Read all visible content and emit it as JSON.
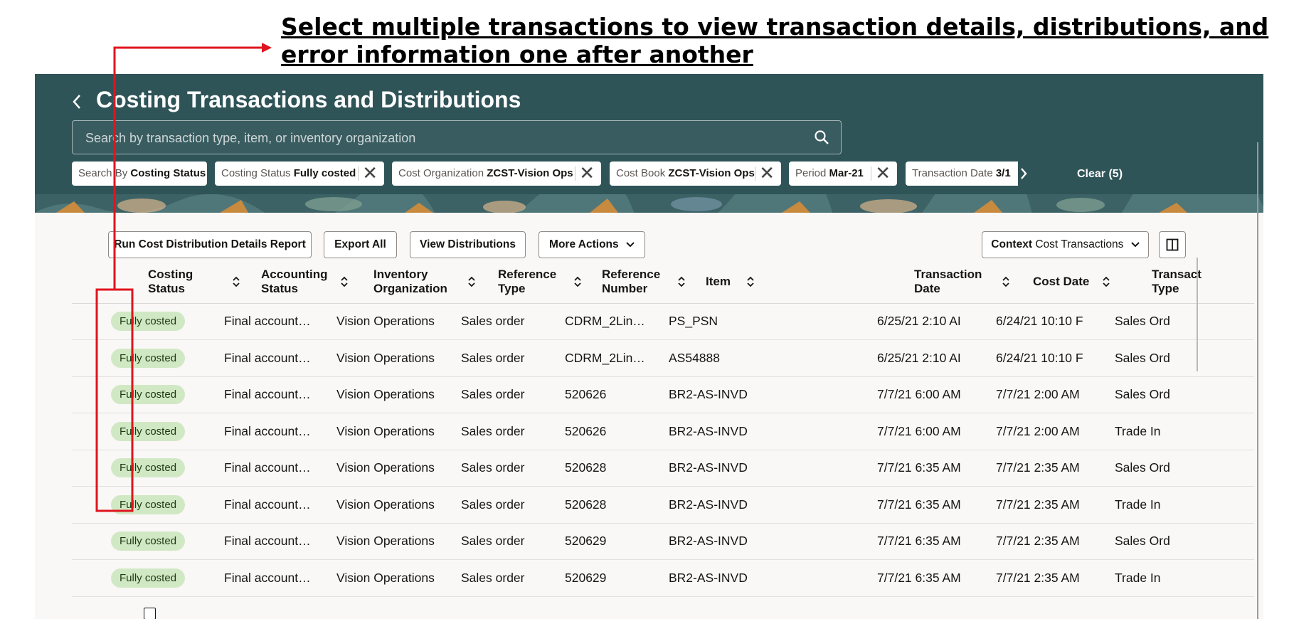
{
  "annotation": {
    "line1": "Select multiple transactions to view transaction details, distributions, and",
    "line2": "error information one after another"
  },
  "header": {
    "title": "Costing Transactions and Distributions",
    "search_placeholder": "Search by transaction type, item, or inventory organization",
    "chips": [
      {
        "label": "Search By",
        "value": "Costing Status"
      },
      {
        "label": "Costing Status",
        "value": "Fully costed"
      },
      {
        "label": "Cost Organization",
        "value": "ZCST-Vision Ops"
      },
      {
        "label": "Cost Book",
        "value": "ZCST-Vision Ops"
      },
      {
        "label": "Period",
        "value": "Mar-21"
      },
      {
        "label": "Transaction Date",
        "value": "3/1"
      }
    ],
    "clear_label": "Clear (5)"
  },
  "toolbar": {
    "run_report": "Run Cost Distribution Details Report",
    "export_all": "Export All",
    "view_distributions": "View Distributions",
    "more_actions": "More Actions",
    "context_label": "Context",
    "context_value": "Cost Transactions"
  },
  "table": {
    "columns": [
      {
        "line1": "Costing",
        "line2": "Status"
      },
      {
        "line1": "Accounting",
        "line2": "Status"
      },
      {
        "line1": "Inventory",
        "line2": "Organization"
      },
      {
        "line1": "Reference",
        "line2": "Type"
      },
      {
        "line1": "Reference",
        "line2": "Number"
      },
      {
        "line1": "Item",
        "line2": ""
      },
      {
        "line1": "Transaction",
        "line2": "Date"
      },
      {
        "line1": "Cost Date",
        "line2": ""
      },
      {
        "line1": "Transact",
        "line2": "Type"
      }
    ],
    "rows": [
      {
        "checked": true,
        "costing_status": "Fully costed",
        "accounting_status": "Final account…",
        "inventory_org": "Vision Operations",
        "reference_type": "Sales order",
        "reference_number": "CDRM_2Lin…",
        "item": "PS_PSN",
        "transaction_date": "6/25/21 2:10 AI",
        "cost_date": "6/24/21 10:10 F",
        "transaction_type": "Sales Ord"
      },
      {
        "checked": true,
        "costing_status": "Fully costed",
        "accounting_status": "Final account…",
        "inventory_org": "Vision Operations",
        "reference_type": "Sales order",
        "reference_number": "CDRM_2Lin…",
        "item": "AS54888",
        "transaction_date": "6/25/21 2:10 AI",
        "cost_date": "6/24/21 10:10 F",
        "transaction_type": "Sales Ord"
      },
      {
        "checked": true,
        "costing_status": "Fully costed",
        "accounting_status": "Final account…",
        "inventory_org": "Vision Operations",
        "reference_type": "Sales order",
        "reference_number": "520626",
        "item": "BR2-AS-INVD",
        "transaction_date": "7/7/21 6:00 AM",
        "cost_date": "7/7/21 2:00 AM",
        "transaction_type": "Sales Ord"
      },
      {
        "checked": true,
        "costing_status": "Fully costed",
        "accounting_status": "Final account…",
        "inventory_org": "Vision Operations",
        "reference_type": "Sales order",
        "reference_number": "520626",
        "item": "BR2-AS-INVD",
        "transaction_date": "7/7/21 6:00 AM",
        "cost_date": "7/7/21 2:00 AM",
        "transaction_type": "Trade In"
      },
      {
        "checked": true,
        "costing_status": "Fully costed",
        "accounting_status": "Final account…",
        "inventory_org": "Vision Operations",
        "reference_type": "Sales order",
        "reference_number": "520628",
        "item": "BR2-AS-INVD",
        "transaction_date": "7/7/21 6:35 AM",
        "cost_date": "7/7/21 2:35 AM",
        "transaction_type": "Sales Ord"
      },
      {
        "checked": true,
        "costing_status": "Fully costed",
        "accounting_status": "Final account…",
        "inventory_org": "Vision Operations",
        "reference_type": "Sales order",
        "reference_number": "520628",
        "item": "BR2-AS-INVD",
        "transaction_date": "7/7/21 6:35 AM",
        "cost_date": "7/7/21 2:35 AM",
        "transaction_type": "Trade In"
      },
      {
        "checked": false,
        "costing_status": "Fully costed",
        "accounting_status": "Final account…",
        "inventory_org": "Vision Operations",
        "reference_type": "Sales order",
        "reference_number": "520629",
        "item": "BR2-AS-INVD",
        "transaction_date": "7/7/21 6:35 AM",
        "cost_date": "7/7/21 2:35 AM",
        "transaction_type": "Sales Ord"
      },
      {
        "checked": false,
        "costing_status": "Fully costed",
        "accounting_status": "Final account…",
        "inventory_org": "Vision Operations",
        "reference_type": "Sales order",
        "reference_number": "520629",
        "item": "BR2-AS-INVD",
        "transaction_date": "7/7/21 6:35 AM",
        "cost_date": "7/7/21 2:35 AM",
        "transaction_type": "Trade In"
      },
      {
        "checked": false,
        "costing_status": "",
        "accounting_status": "",
        "inventory_org": "",
        "reference_type": "",
        "reference_number": "",
        "item": "",
        "transaction_date": "",
        "cost_date": "",
        "transaction_type": ""
      }
    ]
  },
  "colors": {
    "header_bg": "#2f5458",
    "badge_bg": "#d1e8c4",
    "annotation_red": "#e0141e"
  },
  "icons": [
    "back-chevron-icon",
    "search-icon",
    "close-icon",
    "chevron-right-icon",
    "chevron-down-icon",
    "column-layout-icon",
    "sort-icon",
    "checkbox-icon"
  ]
}
